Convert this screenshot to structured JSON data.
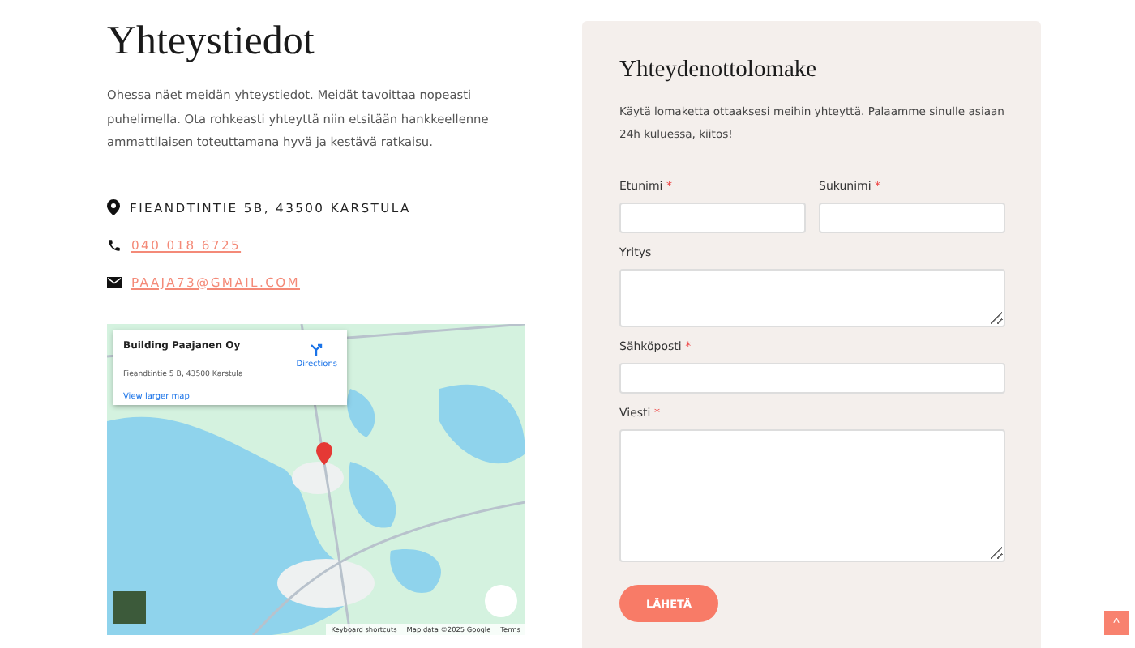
{
  "contact": {
    "title": "Yhteystiedot",
    "intro": "Ohessa näet meidän yhteystiedot. Meidät tavoittaa nopeasti puhelimella. Ota rohkeasti yhteyttä niin etsitään hankkeellenne ammattilaisen toteuttamana hyvä ja kestävä ratkaisu.",
    "items": [
      {
        "kind": "address",
        "text": "FIEANDTINTIE 5B, 43500 KARSTULA"
      },
      {
        "kind": "phone",
        "text": "040 018 6725"
      },
      {
        "kind": "email",
        "text": "PAAJA73@GMAIL.COM"
      }
    ]
  },
  "map": {
    "kind": "picture",
    "card": {
      "name": "Building Paajanen Oy",
      "address": "Fieandtintie 5 B, 43500 Karstula",
      "directions": "Directions",
      "larger_map": "View larger map"
    },
    "footer": [
      "Keyboard shortcuts",
      "Map data ©2025 Google",
      "Terms"
    ]
  },
  "form": {
    "title": "Yhteydenottolomake",
    "intro": "Käytä lomaketta ottaaksesi meihin yhteyttä. Palaamme sinulle asiaan 24h kuluessa, kiitos!",
    "rows": [
      [
        {
          "label": "Etunimi",
          "required": true,
          "kind": "input"
        },
        {
          "label": "Sukunimi",
          "required": true,
          "kind": "input"
        }
      ],
      [
        {
          "label": "Yritys",
          "required": false,
          "kind": "textarea"
        }
      ],
      [
        {
          "label": "Sähköposti",
          "required": true,
          "kind": "input"
        }
      ],
      [
        {
          "label": "Viesti",
          "required": true,
          "kind": "textarea-large"
        }
      ]
    ],
    "required_mark": "*",
    "submit": "LÄHETÄ"
  },
  "scroll_top": "^"
}
